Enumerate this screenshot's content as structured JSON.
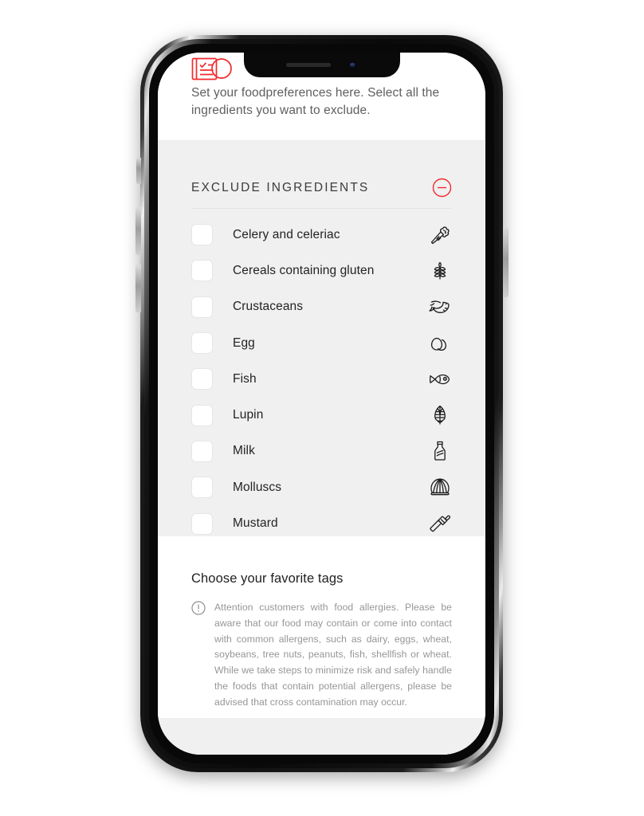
{
  "brand": {
    "logo_icon": "checklist-clipboard-icon",
    "logo_color": "#f22a2e"
  },
  "header": {
    "intro_text": "Set your foodpreferences here. Select all the ingredients you want to exclude."
  },
  "exclude_section": {
    "title": "EXCLUDE INGREDIENTS",
    "collapse_icon": "circle-minus-icon",
    "collapse_color": "#f22a2e",
    "items": [
      {
        "label": "Celery and celeriac",
        "icon": "celery-icon",
        "checked": false
      },
      {
        "label": "Cereals containing gluten",
        "icon": "wheat-icon",
        "checked": false
      },
      {
        "label": "Crustaceans",
        "icon": "shrimp-icon",
        "checked": false
      },
      {
        "label": "Egg",
        "icon": "egg-icon",
        "checked": false
      },
      {
        "label": "Fish",
        "icon": "fish-icon",
        "checked": false
      },
      {
        "label": "Lupin",
        "icon": "lupin-icon",
        "checked": false
      },
      {
        "label": "Milk",
        "icon": "milk-bottle-icon",
        "checked": false
      },
      {
        "label": "Molluscs",
        "icon": "shell-icon",
        "checked": false
      },
      {
        "label": "Mustard",
        "icon": "mustard-icon",
        "checked": false
      }
    ]
  },
  "tags_section": {
    "title": "Choose your favorite tags",
    "warning_icon": "exclamation-circle-icon",
    "disclaimer": "Attention customers with food allergies. Please be aware that our food may contain or come into contact with common allergens, such as dairy, eggs, wheat, soybeans, tree nuts, peanuts, fish, shellfish or wheat. While we take steps to minimize risk and safely handle the foods that contain potential allergens, please be advised that cross contamination may occur."
  },
  "colors": {
    "accent_red": "#f22a2e",
    "panel_gray": "#f0f0f0",
    "text_dark": "#232325",
    "text_muted": "#96969a"
  }
}
